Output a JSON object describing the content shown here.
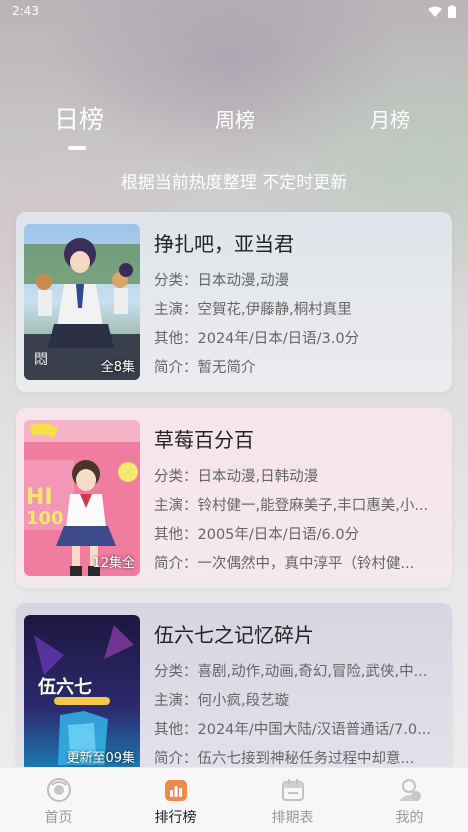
{
  "status_bar": {
    "time": "2:43"
  },
  "tabs": [
    {
      "label": "日榜",
      "active": true
    },
    {
      "label": "周榜",
      "active": false
    },
    {
      "label": "月榜",
      "active": false
    }
  ],
  "subtitle": "根据当前热度整理 不定时更新",
  "items": [
    {
      "title": "挣扎吧，亚当君",
      "category": "分类：日本动漫,动漫",
      "cast": "主演：空賀花,伊藤静,桐村真里",
      "other": "其他：2024年/日本/日语/3.0分",
      "intro": "简介：暂无简介",
      "episode": "全8集"
    },
    {
      "title": "草莓百分百",
      "category": "分类：日本动漫,日韩动漫",
      "cast": "主演：铃村健一,能登麻美子,丰口惠美,小...",
      "other": "其他：2005年/日本/日语/6.0分",
      "intro": "简介：一次偶然中，真中淳平（铃村健...",
      "episode": "12集全"
    },
    {
      "title": "伍六七之记忆碎片",
      "category": "分类：喜剧,动作,动画,奇幻,冒险,武侠,中...",
      "cast": "主演：何小疯,段艺璇",
      "other": "其他：2024年/中国大陆/汉语普通话/7.0...",
      "intro": "简介：伍六七接到神秘任务过程中却意...",
      "episode": "更新至09集"
    }
  ],
  "nav": [
    {
      "label": "首页",
      "icon": "home-icon",
      "active": false
    },
    {
      "label": "排行榜",
      "icon": "ranking-icon",
      "active": true
    },
    {
      "label": "排期表",
      "icon": "schedule-icon",
      "active": false
    },
    {
      "label": "我的",
      "icon": "profile-icon",
      "active": false
    }
  ],
  "colors": {
    "accent": "#e8703a",
    "nav_inactive": "#999999",
    "nav_active": "#222222"
  }
}
